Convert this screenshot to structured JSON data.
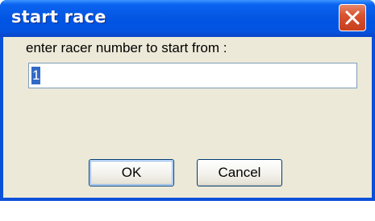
{
  "dialog": {
    "title": "start race",
    "close_icon": "close-icon",
    "prompt": "enter racer number to start from :",
    "input_value": "1",
    "ok_label": "OK",
    "cancel_label": "Cancel"
  },
  "colors": {
    "titlebar": "#0054e3",
    "body": "#ece9d8",
    "close_button": "#d8532f",
    "selection": "#316ac5"
  }
}
